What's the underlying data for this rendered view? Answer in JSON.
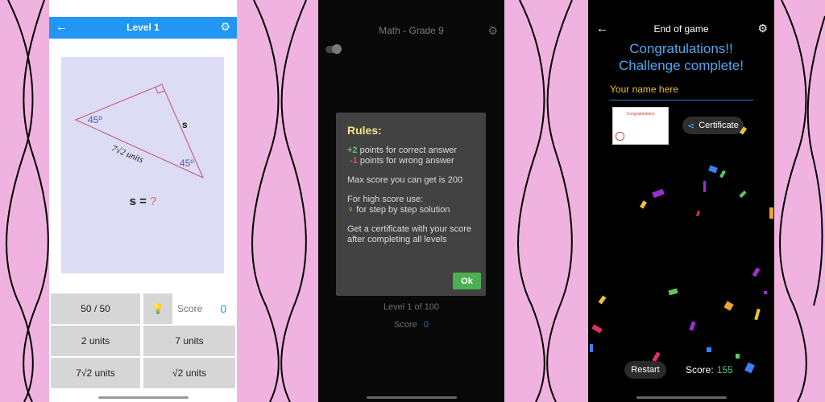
{
  "phone1": {
    "title": "Level 1",
    "figure": {
      "angle_top_label": "45º",
      "angle_bottom_label": "45º",
      "side_label": "s",
      "hyp_label": "7√2 units"
    },
    "question": {
      "lhs": "s =",
      "mark": "?"
    },
    "answer_grid": {
      "lifelines": "50 / 50",
      "score_label": "Score",
      "score_value": "0",
      "options": [
        "2 units",
        "7 units",
        "7√2 units",
        "√2 units"
      ]
    },
    "colors": {
      "appbar": "#2196f3"
    }
  },
  "phone2": {
    "title": "Math - Grade 9",
    "rules": {
      "title": "Rules:",
      "plus_points": "+2",
      "plus_text": " points for correct answer",
      "minus_points": "-1",
      "minus_text": " points for wrong answer",
      "max_score": "Max score you can get is 200",
      "high_score_intro": "For high score use:",
      "step_text": " for step by step solution",
      "certificate": "Get a certificate with your score after completing all levels",
      "ok_button": "Ok"
    },
    "level": "Level 1 of 100",
    "score_label": "Score",
    "score_value": "0"
  },
  "phone3": {
    "title": "End of game",
    "congrats_line1": "Congratulations!!",
    "congrats_line2": "Challenge complete!",
    "name_placeholder": "Your name here",
    "certificate_thumb": "Congratulations",
    "certificate_button": "Certificate",
    "restart_button": "Restart",
    "score_label": "Score:",
    "score_value": "155"
  }
}
